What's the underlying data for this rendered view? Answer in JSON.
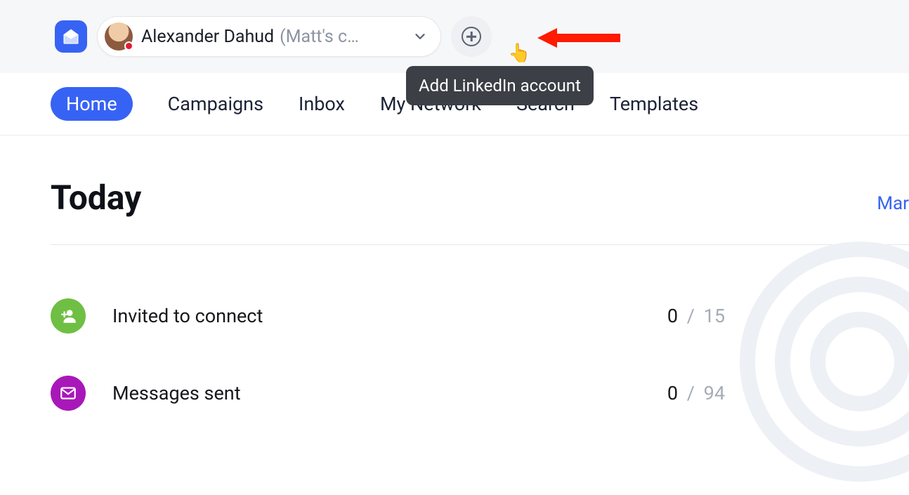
{
  "header": {
    "account_name": "Alexander Dahud",
    "account_sub": "(Matt's c…",
    "tooltip": "Add LinkedIn account"
  },
  "tabs": {
    "items": [
      "Home",
      "Campaigns",
      "Inbox",
      "My Network",
      "Search",
      "Templates"
    ],
    "active_index": 0
  },
  "today": {
    "title": "Today",
    "manage_link": "Mar"
  },
  "stats": [
    {
      "icon": "invite",
      "color": "green",
      "label": "Invited to connect",
      "value": 0,
      "max": 15
    },
    {
      "icon": "mail",
      "color": "purple",
      "label": "Messages sent",
      "value": 0,
      "max": 94
    }
  ]
}
